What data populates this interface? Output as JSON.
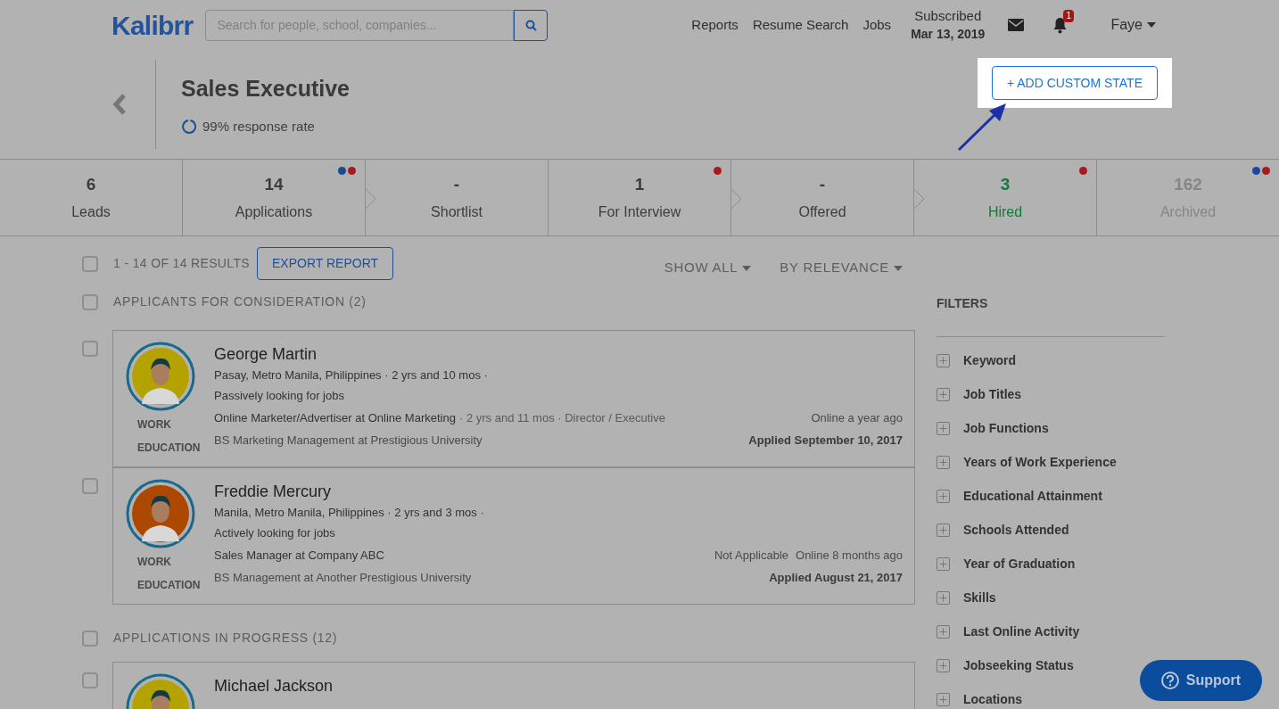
{
  "header": {
    "logo": "Kalibrr",
    "search": {
      "placeholder": "Search for people, school, companies..."
    },
    "nav": [
      "Reports",
      "Resume Search",
      "Jobs"
    ],
    "subscription": {
      "label": "Subscribed",
      "date": "Mar 13, 2019"
    },
    "notifications": {
      "count": "1"
    },
    "user": "Faye"
  },
  "job": {
    "title": "Sales Executive",
    "response_rate": "99% response rate"
  },
  "add_button": "+ ADD CUSTOM STATE",
  "stages": [
    {
      "count": "6",
      "label": "Leads",
      "kind": "normal",
      "chevron": false
    },
    {
      "count": "14",
      "label": "Applications",
      "kind": "normal",
      "chevron": false,
      "dots": [
        {
          "color": "#1a4a99"
        },
        {
          "color": "#aa1a1a"
        }
      ]
    },
    {
      "count": "-",
      "label": "Shortlist",
      "kind": "normal",
      "chevron": true
    },
    {
      "count": "1",
      "label": "For Interview",
      "kind": "normal",
      "chevron": false,
      "dots": [
        {
          "color": "#aa1a1a"
        }
      ]
    },
    {
      "count": "-",
      "label": "Offered",
      "kind": "normal",
      "chevron": true
    },
    {
      "count": "3",
      "label": "Hired",
      "kind": "hired",
      "chevron": true,
      "dots": [
        {
          "color": "#aa1a1a"
        }
      ]
    },
    {
      "count": "162",
      "label": "Archived",
      "kind": "archived",
      "chevron": false,
      "dots": [
        {
          "color": "#1a4a99"
        },
        {
          "color": "#aa1a1a"
        }
      ]
    }
  ],
  "results": {
    "checked": false,
    "summary": "1 - 14 OF 14 RESULTS",
    "export": "EXPORT REPORT",
    "show": "SHOW ALL",
    "sort": "BY RELEVANCE"
  },
  "sections": [
    {
      "title": "APPLICANTS FOR CONSIDERATION (2)",
      "checked": false,
      "applicants": [
        {
          "checked": false,
          "color": "#b3a200",
          "name": "George Martin",
          "location": "Pasay, Metro Manila, Philippines · 2 yrs and 10 mos ·",
          "status": "Passively looking for jobs",
          "work_label": "WORK",
          "work": "Online Marketer/Advertiser at Online Marketing",
          "work_extra": "· 2 yrs and 11 mos · Director / Executive",
          "education_label": "EDUCATION",
          "education": "BS Marketing Management at Prestigious University",
          "online": "Online a year ago",
          "applied": "Applied September 10, 2017"
        },
        {
          "checked": false,
          "color": "#ad4800",
          "name": "Freddie Mercury",
          "location": "Manila, Metro Manila, Philippines · 2 yrs and 3 mos ·",
          "status": "Actively looking for jobs",
          "work_label": "WORK",
          "work": "Sales Manager at Company ABC",
          "education_label": "EDUCATION",
          "education": "BS Management at Another Prestigious University",
          "note": "Not Applicable",
          "online": "Online 8 months ago",
          "applied": "Applied August 21, 2017"
        }
      ]
    },
    {
      "title": "APPLICATIONS IN PROGRESS (12)",
      "checked": false,
      "applicants": [
        {
          "checked": false,
          "color": "#b3a200",
          "name": "Michael Jackson"
        }
      ]
    }
  ],
  "filters": {
    "title": "FILTERS",
    "items": [
      "Keyword",
      "Job Titles",
      "Job Functions",
      "Years of Work Experience",
      "Educational Attainment",
      "Schools Attended",
      "Year of Graduation",
      "Skills",
      "Last Online Activity",
      "Jobseeking Status",
      "Locations"
    ]
  },
  "support": "Support"
}
